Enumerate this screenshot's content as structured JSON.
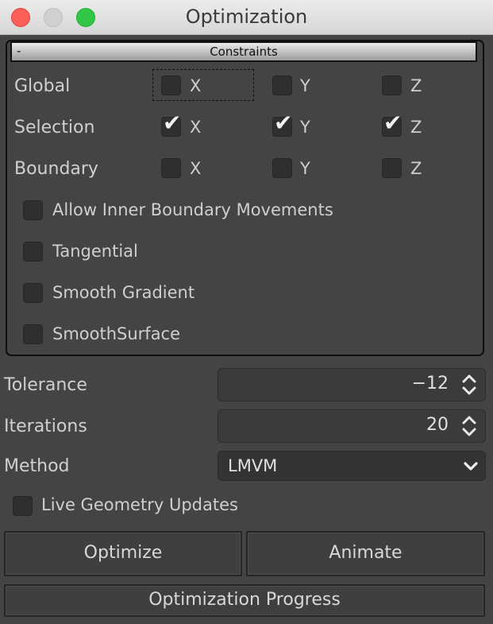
{
  "window": {
    "title": "Optimization"
  },
  "constraints": {
    "toggle": "-",
    "title": "Constraints",
    "rows": [
      {
        "label": "Global",
        "x": {
          "label": "X",
          "checked": false
        },
        "y": {
          "label": "Y",
          "checked": false
        },
        "z": {
          "label": "Z",
          "checked": false
        }
      },
      {
        "label": "Selection",
        "x": {
          "label": "X",
          "checked": true
        },
        "y": {
          "label": "Y",
          "checked": true
        },
        "z": {
          "label": "Z",
          "checked": true
        }
      },
      {
        "label": "Boundary",
        "x": {
          "label": "X",
          "checked": false
        },
        "y": {
          "label": "Y",
          "checked": false
        },
        "z": {
          "label": "Z",
          "checked": false
        }
      }
    ],
    "options": [
      {
        "label": "Allow Inner Boundary Movements",
        "checked": false
      },
      {
        "label": "Tangential",
        "checked": false
      },
      {
        "label": "Smooth Gradient",
        "checked": false
      },
      {
        "label": "SmoothSurface",
        "checked": false
      }
    ]
  },
  "tolerance": {
    "label": "Tolerance",
    "value": "−12"
  },
  "iterations": {
    "label": "Iterations",
    "value": "20"
  },
  "method": {
    "label": "Method",
    "value": "LMVM"
  },
  "live_updates": {
    "label": "Live Geometry Updates",
    "checked": false
  },
  "buttons": {
    "optimize": "Optimize",
    "animate": "Animate",
    "progress": "Optimization Progress"
  }
}
